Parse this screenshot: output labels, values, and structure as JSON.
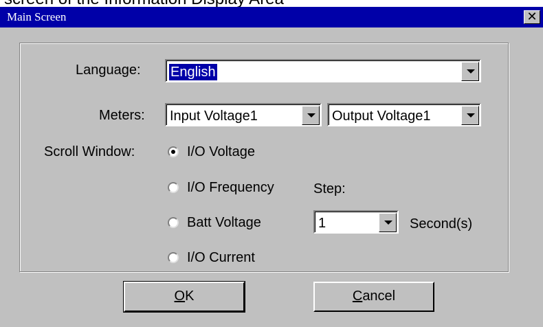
{
  "page_caption": "screen of the Information Display Area",
  "window": {
    "title": "Main Screen",
    "close_glyph": "✕"
  },
  "language": {
    "label": "Language:",
    "value": "English"
  },
  "meters": {
    "label": "Meters:",
    "left_value": "Input Voltage1",
    "right_value": "Output Voltage1"
  },
  "scroll_window": {
    "label": "Scroll Window:",
    "options": [
      {
        "label": "I/O Voltage",
        "checked": true
      },
      {
        "label": "I/O Frequency",
        "checked": false
      },
      {
        "label": "Batt Voltage",
        "checked": false
      },
      {
        "label": "I/O Current",
        "checked": false
      }
    ],
    "step_label": "Step:",
    "step_value": "1",
    "step_unit": "Second(s)"
  },
  "buttons": {
    "ok_mnemonic": "O",
    "ok_rest": "K",
    "cancel_mnemonic": "C",
    "cancel_rest": "ancel"
  },
  "colors": {
    "title_bar": "#0000a8",
    "face": "#c0c0c0",
    "selection": "#0000a8"
  }
}
